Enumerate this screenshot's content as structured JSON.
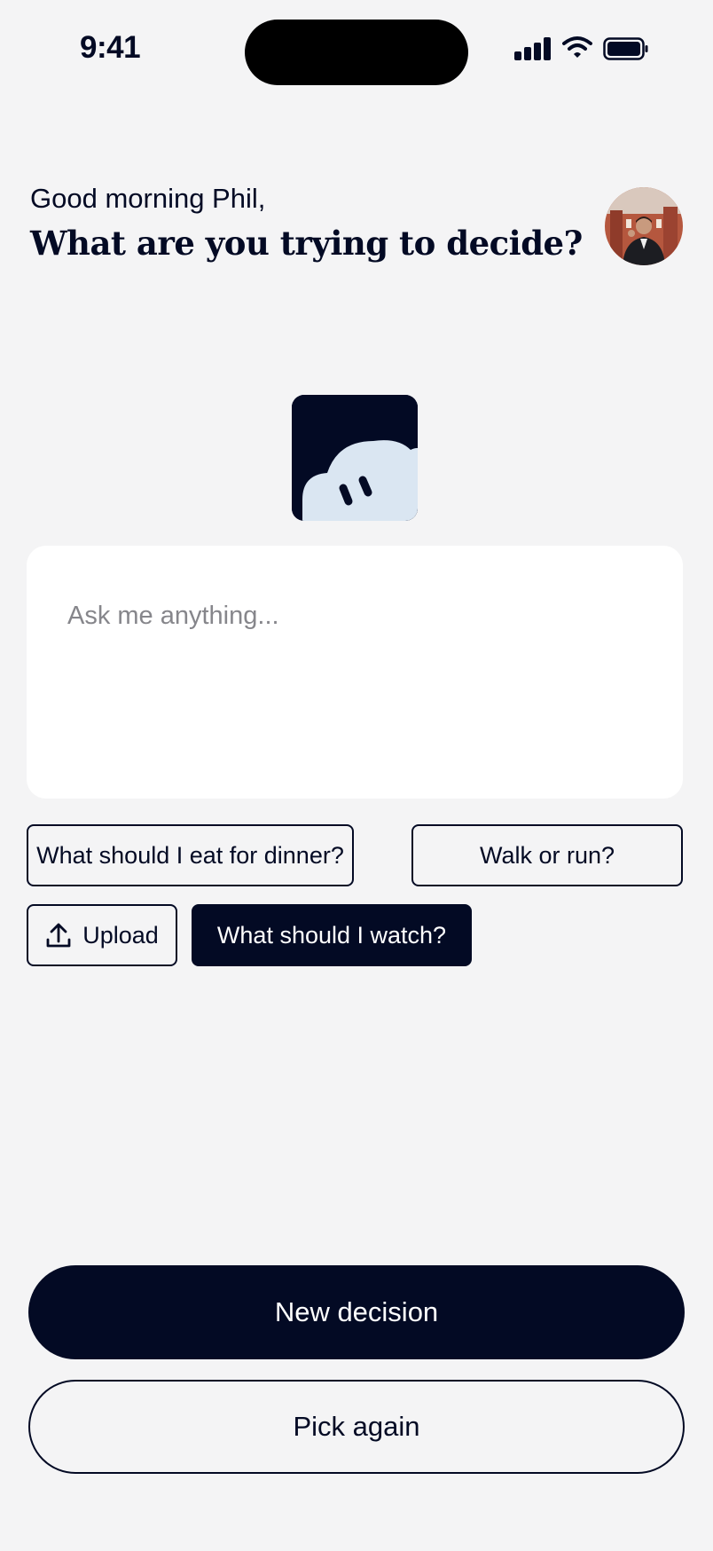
{
  "status_bar": {
    "time": "9:41"
  },
  "header": {
    "greeting": "Good morning Phil,",
    "question": "What are you trying to decide?"
  },
  "ask": {
    "placeholder": "Ask me anything..."
  },
  "suggestions": {
    "dinner": "What should I eat for dinner?",
    "walk": "Walk or run?",
    "upload": "Upload",
    "watch": "What should I watch?"
  },
  "actions": {
    "new_decision": "New decision",
    "pick_again": "Pick again"
  },
  "colors": {
    "accent": "#030a24",
    "background": "#f4f4f5",
    "mascot_cloud": "#dae6f2"
  },
  "icons": [
    "cellular-signal-icon",
    "wifi-icon",
    "battery-icon",
    "upload-icon"
  ]
}
